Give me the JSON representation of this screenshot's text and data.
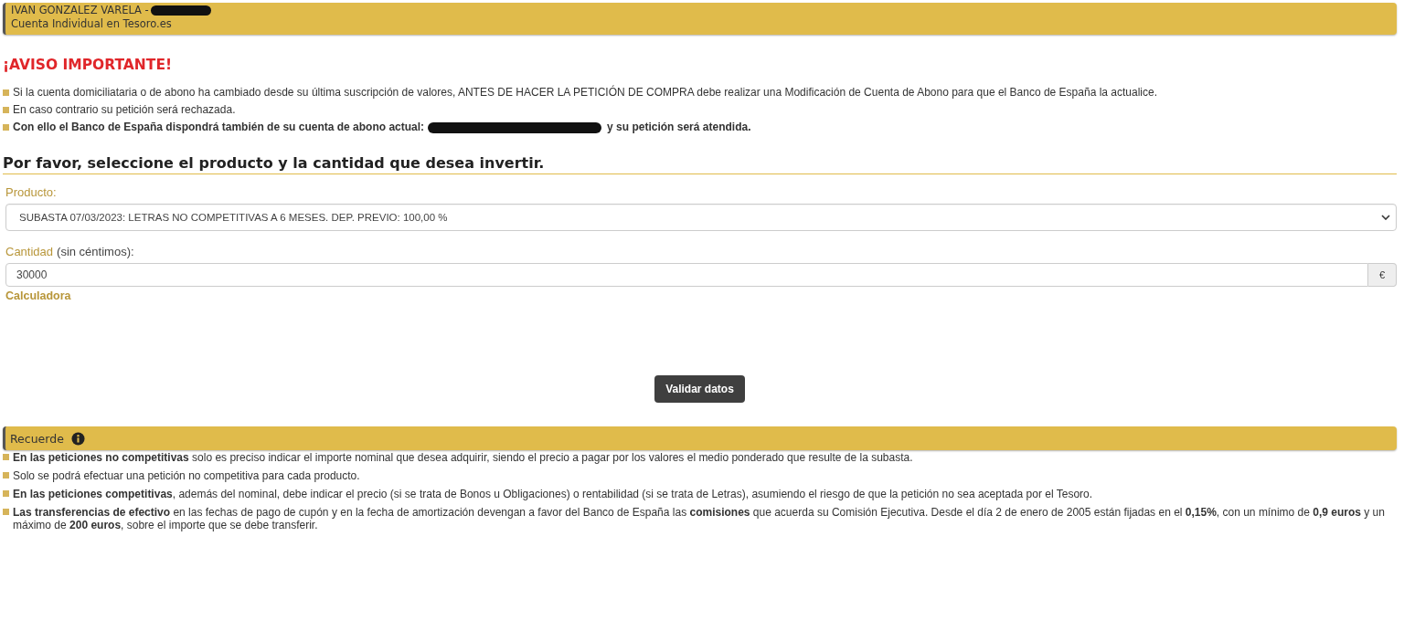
{
  "header": {
    "name": "IVAN GONZALEZ VARELA -",
    "name_redacted": true,
    "account": "Cuenta Individual en Tesoro.es"
  },
  "notice": {
    "title": "¡AVISO IMPORTANTE!",
    "items": [
      {
        "text": "Si la cuenta domiciliataria o de abono ha cambiado desde su última suscripción de valores, ANTES DE HACER LA PETICIÓN DE COMPRA debe realizar una Modificación de Cuenta de Abono para que el Banco de España la actualice.",
        "bold": false,
        "redacted": false
      },
      {
        "text": "En caso contrario su petición será rechazada.",
        "bold": false,
        "redacted": false
      },
      {
        "text": "Con ello el Banco de España dispondrá también de su cuenta de abono actual:",
        "bold": true,
        "redacted": true,
        "text_after": "y su petición será atendida."
      }
    ]
  },
  "form": {
    "heading": "Por favor, seleccione el producto y la cantidad que desea invertir.",
    "product": {
      "label": "Producto:",
      "value": "SUBASTA 07/03/2023: LETRAS NO COMPETITIVAS A 6 MESES. DEP. PREVIO: 100,00 %"
    },
    "quantity": {
      "label": "Cantidad",
      "note": "(sin céntimos):",
      "value": "30000",
      "unit": "€"
    },
    "calculator_link": "Calculadora",
    "submit": "Validar datos"
  },
  "reminder": {
    "title": "Recuerde",
    "items": [
      "**En las peticiones no competitivas** solo es preciso indicar el importe nominal que desea adquirir, siendo el precio a pagar por los valores el medio ponderado que resulte de la subasta.",
      "Solo se podrá efectuar una petición no competitiva para cada producto.",
      "**En las peticiones competitivas**, además del nominal, debe indicar el precio (si se trata de Bonos u Obligaciones) o rentabilidad (si se trata de Letras), asumiendo el riesgo de que la petición no sea aceptada por el Tesoro.",
      "**Las transferencias de efectivo** en las fechas de pago de cupón y en la fecha de amortización devengan a favor del Banco de España las **comisiones** que acuerda su Comisión Ejecutiva. Desde el día 2 de enero de 2005 están fijadas en el **0,15%**, con un mínimo de **0,9 euros** y un máximo de **200 euros**, sobre el importe que se debe transferir."
    ]
  }
}
